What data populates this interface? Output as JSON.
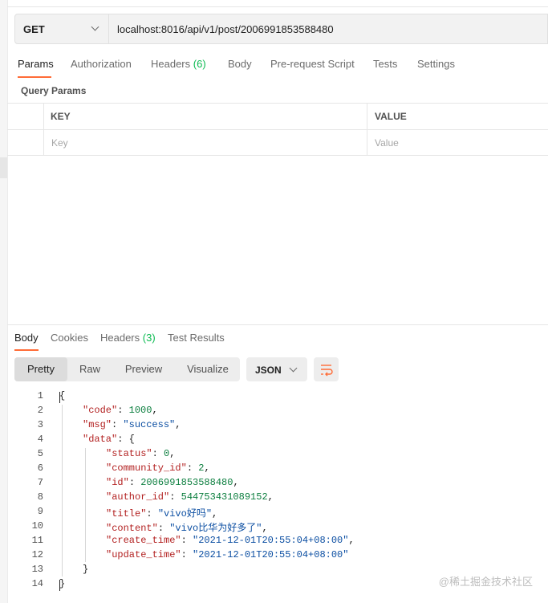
{
  "request": {
    "method": "GET",
    "url": "localhost:8016/api/v1/post/2006991853588480"
  },
  "request_tabs": [
    {
      "label": "Params",
      "count": ""
    },
    {
      "label": "Authorization",
      "count": ""
    },
    {
      "label": "Headers",
      "count": "(6)"
    },
    {
      "label": "Body",
      "count": ""
    },
    {
      "label": "Pre-request Script",
      "count": ""
    },
    {
      "label": "Tests",
      "count": ""
    },
    {
      "label": "Settings",
      "count": ""
    }
  ],
  "query_params": {
    "title": "Query Params",
    "columns": [
      "KEY",
      "VALUE"
    ],
    "placeholders": [
      "Key",
      "Value"
    ]
  },
  "response_tabs": [
    {
      "label": "Body",
      "count": ""
    },
    {
      "label": "Cookies",
      "count": ""
    },
    {
      "label": "Headers",
      "count": "(3)"
    },
    {
      "label": "Test Results",
      "count": ""
    }
  ],
  "view_modes": [
    "Pretty",
    "Raw",
    "Preview",
    "Visualize"
  ],
  "active_view_mode": "Pretty",
  "format": "JSON",
  "response_lines": [
    "{",
    "\"code\": 1000,",
    "\"msg\": \"success\",",
    "\"data\": {",
    "\"status\": 0,",
    "\"community_id\": 2,",
    "\"id\": 2006991853588480,",
    "\"author_id\": 544753431089152,",
    "\"title\": \"vivo好吗\",",
    "\"content\": \"vivo比华为好多了\",",
    "\"create_time\": \"2021-12-01T20:55:04+08:00\",",
    "\"update_time\": \"2021-12-01T20:55:04+08:00\"",
    "}",
    "}"
  ],
  "watermark": "@稀土掘金技术社区",
  "colors": {
    "accent": "#ff6c37",
    "count": "#0cbb52",
    "json_key": "#b21f1f",
    "json_string": "#0b4ea2",
    "json_number": "#0b7e3e"
  }
}
